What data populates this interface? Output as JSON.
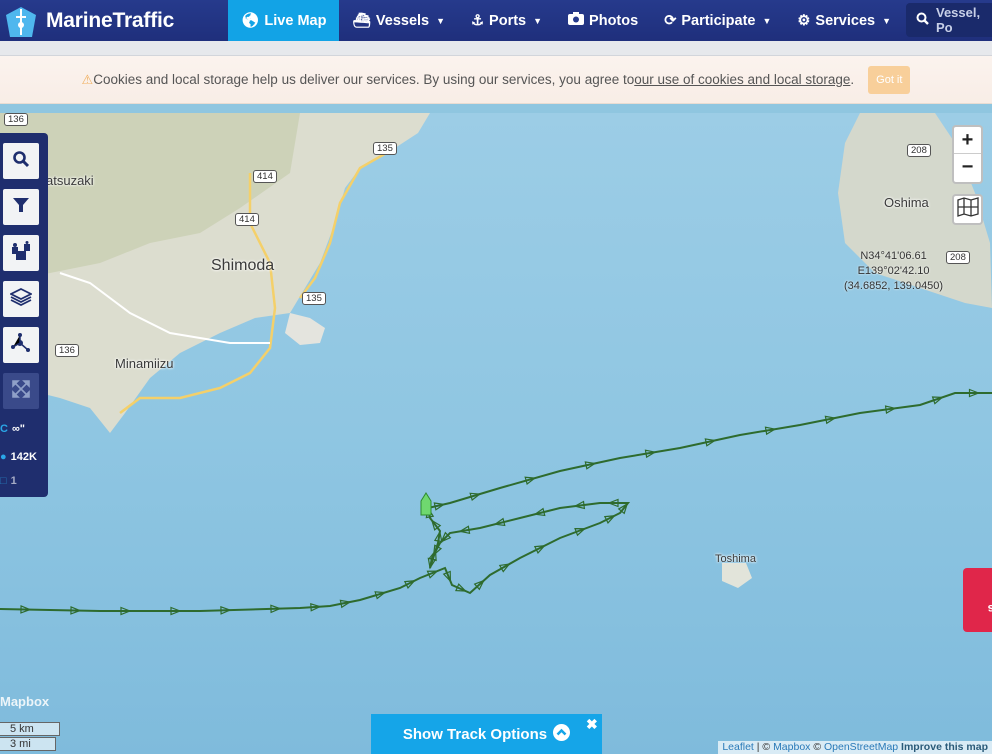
{
  "brand": {
    "name": "MarineTraffic"
  },
  "nav": {
    "items": [
      {
        "label": "Live Map",
        "icon": "globe-icon",
        "active": true,
        "dropdown": false
      },
      {
        "label": "Vessels",
        "icon": "ship-icon",
        "active": false,
        "dropdown": true
      },
      {
        "label": "Ports",
        "icon": "anchor-icon",
        "active": false,
        "dropdown": true
      },
      {
        "label": "Photos",
        "icon": "camera-icon",
        "active": false,
        "dropdown": false
      },
      {
        "label": "Participate",
        "icon": "refresh-icon",
        "active": false,
        "dropdown": true
      },
      {
        "label": "Services",
        "icon": "gear-icon",
        "active": false,
        "dropdown": true
      }
    ],
    "search_placeholder": "Vessel, Po"
  },
  "cookie_banner": {
    "text": "Cookies and local storage help us deliver our services. By using our services, you agree to",
    "link": "our use of cookies and local storage",
    "suffix": ".",
    "button": "Got it"
  },
  "sidebar": {
    "tools": [
      "search-icon",
      "filter-icon",
      "fleet-icon",
      "layers-icon",
      "network-icon",
      "fullscreen-icon"
    ],
    "stats": [
      {
        "icon": "refresh-icon",
        "value": "∞\""
      },
      {
        "icon": "vessel-count-icon",
        "value": "142K"
      },
      {
        "icon": "square-icon",
        "value": "1"
      }
    ]
  },
  "map": {
    "place_labels": [
      "atsuzaki",
      "Shimoda",
      "Minamiizu",
      "Oshima",
      "Toshima"
    ],
    "road_shields": [
      "136",
      "135",
      "414",
      "414",
      "135",
      "136",
      "208",
      "208"
    ],
    "coordinates": {
      "lat_dms": "N34°41'06.61",
      "lon_dms": "E139°02'42.10",
      "decimal": "(34.6852, 139.0450)"
    },
    "zoom_in": "+",
    "zoom_out": "−",
    "mapbox_logo": "Mapbox",
    "scale": {
      "metric": "5 km",
      "imperial": "3 mi"
    },
    "attribution": {
      "leaflet": "Leaflet",
      "sep": " | © ",
      "mapbox": "Mapbox",
      "osm_prefix": " © ",
      "osm": "OpenStreetMap",
      "improve": " Improve this map"
    },
    "track_color": "#2e6b2e",
    "vessel_color": "#6fd86f"
  },
  "track_options": {
    "label": "Show Track Options",
    "close": "✖"
  },
  "news": {
    "label": "News"
  }
}
